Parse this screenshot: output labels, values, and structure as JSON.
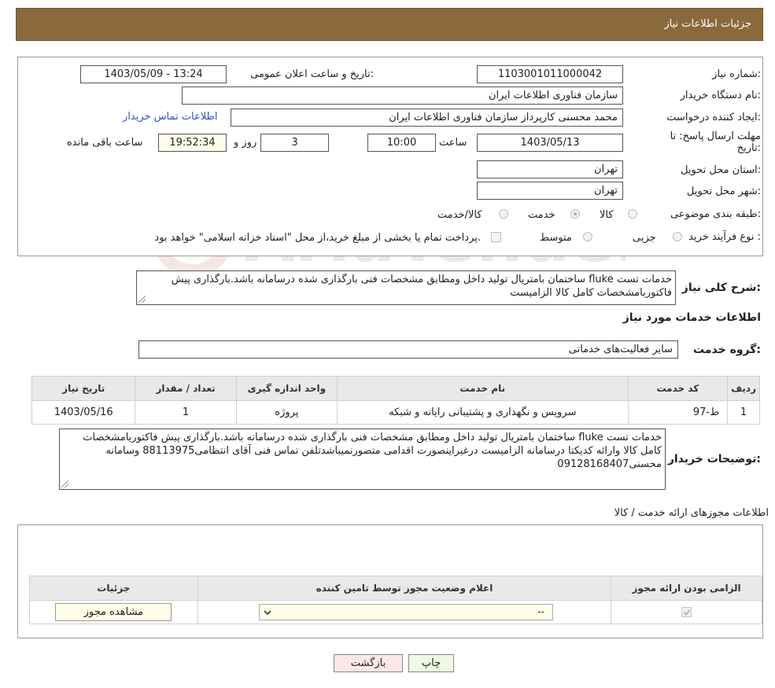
{
  "header": {
    "title": "جزئیات اطلاعات نیاز"
  },
  "form": {
    "need_number_label": "شماره نیاز:",
    "need_number": "1103001011000042",
    "announce_label": "تاریخ و ساعت اعلان عمومی:",
    "announce_value": "1403/05/09 - 13:24",
    "buyer_org_label": "نام دستگاه خریدار:",
    "buyer_org": "سازمان فناوری اطلاعات ایران",
    "creator_label": "ایجاد کننده درخواست:",
    "creator": "محمد محسنی کارپرداز سازمان فناوری اطلاعات ایران",
    "contact_link": "اطلاعات تماس خریدار",
    "deadline_label_1": "مهلت ارسال پاسخ: تا",
    "deadline_label_2": "تاریخ:",
    "deadline_date": "1403/05/13",
    "time_label": "ساعت",
    "deadline_time": "10:00",
    "days_value": "3",
    "days_label": "روز و",
    "remaining_time": "19:52:34",
    "remaining_label": "ساعت باقی مانده",
    "province_label": "استان محل تحویل:",
    "province": "تهران",
    "city_label": "شهر محل تحویل:",
    "city": "تهران",
    "category_label": "طبقه بندی موضوعی:",
    "category_options": [
      "کالا",
      "خدمت",
      "کالا/خدمت"
    ],
    "category_selected": "خدمت",
    "process_label": "نوع فرآیند خرید :",
    "process_options": [
      "جزیی",
      "متوسط"
    ],
    "payment_note": "پرداخت تمام یا بخشی از مبلغ خرید،از محل \"اسناد خزانه اسلامی\" خواهد بود."
  },
  "summary": {
    "label": "شرح کلی نیاز:",
    "text": "خدمات تست fluke ساختمان بامتریال تولید داخل ومطابق مشخصات فنی بارگذاری شده درسامانه باشد.بارگذاری پیش فاکتوربامشخصات کامل کالا  الزامیست"
  },
  "services_section": {
    "title": "اطلاعات خدمات مورد نیاز"
  },
  "service_group": {
    "label": "گروه خدمت:",
    "value": "سایر فعالیت‌های خدماتی"
  },
  "services_table": {
    "headers": [
      "ردیف",
      "کد خدمت",
      "نام خدمت",
      "واحد اندازه گیری",
      "تعداد / مقدار",
      "تاریخ نیاز"
    ],
    "rows": [
      [
        "1",
        "ط-97",
        "سرویس و نگهداری و پشتیبانی رایانه و شبکه",
        "پروژه",
        "1",
        "1403/05/16"
      ]
    ]
  },
  "buyer_notes": {
    "label": "توضیحات خریدار:",
    "text": "خدمات تست fluke ساختمان بامتریال تولید داخل ومطابق مشخصات فنی بارگذاری شده درسامانه باشد.بارگذاری پیش فاکتوربامشخصات کامل کالا وارائه کدیکتا درسامانه الزامیست درغیراینصورت اقدامی متصورنمیباشدتلفن تماس فنی آقای انتظامی88113975 وسامانه محسنی09128168407"
  },
  "permits_section": {
    "title": "اطلاعات مجوزهای ارائه خدمت / کالا"
  },
  "permits_table": {
    "headers": [
      "الزامی بودن ارائه مجوز",
      "اعلام وضعیت مجوز توسط تامین کننده",
      "جزئیات"
    ],
    "select_value": "--",
    "view_button": "مشاهده مجوز"
  },
  "buttons": {
    "print": "چاپ",
    "back": "بازگشت"
  },
  "colors": {
    "header_bg": "#8a6a3c",
    "back_button_bg": "#fde7ea",
    "print_button_bg": "#eef9e6",
    "link": "#2b55c5"
  }
}
